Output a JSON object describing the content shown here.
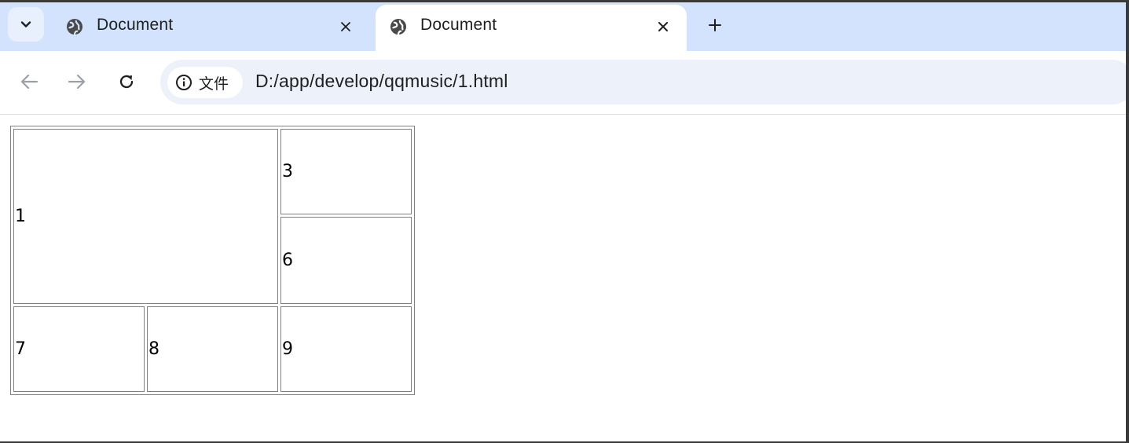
{
  "tabs": [
    {
      "title": "Document",
      "active": false,
      "icon": "globe-icon"
    },
    {
      "title": "Document",
      "active": true,
      "icon": "globe-icon"
    }
  ],
  "toolbar": {
    "site_chip_label": "文件",
    "url": "D:/app/develop/qqmusic/1.html"
  },
  "table": {
    "cells": {
      "c1": "1",
      "c3": "3",
      "c6": "6",
      "c7": "7",
      "c8": "8",
      "c9": "9"
    }
  },
  "colors": {
    "tabstrip": "#d3e3fd",
    "omnibox": "#edf2fa",
    "cell_border": "#808080"
  }
}
